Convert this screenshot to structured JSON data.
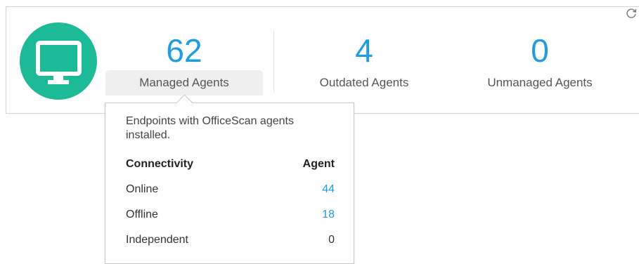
{
  "stats": {
    "managed": {
      "count": "62",
      "label": "Managed Agents"
    },
    "outdated": {
      "count": "4",
      "label": "Outdated Agents"
    },
    "unmanaged": {
      "count": "0",
      "label": "Unmanaged Agents"
    }
  },
  "icons": {
    "monitor": "monitor-icon",
    "refresh": "refresh-icon"
  },
  "colors": {
    "accent": "#1c9ee0",
    "icon_bg": "#1cba97"
  },
  "tooltip": {
    "description": "Endpoints with OfficeScan agents installed.",
    "headers": {
      "connectivity": "Connectivity",
      "agent": "Agent"
    },
    "rows": [
      {
        "label": "Online",
        "value": "44"
      },
      {
        "label": "Offline",
        "value": "18"
      },
      {
        "label": "Independent",
        "value": "0"
      }
    ]
  }
}
